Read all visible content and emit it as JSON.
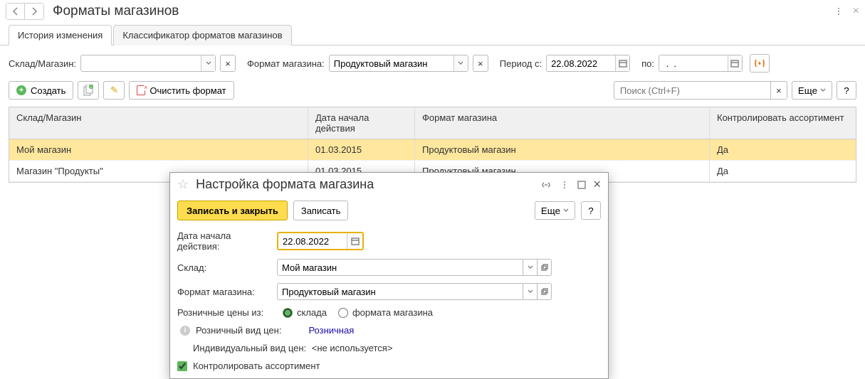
{
  "header": {
    "title": "Форматы магазинов"
  },
  "tabs": {
    "history": "История изменения",
    "classifier": "Классификатор форматов магазинов"
  },
  "filters": {
    "store_label": "Склад/Магазин:",
    "format_label": "Формат магазина:",
    "format_value": "Продуктовый магазин",
    "period_from_label": "Период с:",
    "period_from_value": "22.08.2022",
    "period_to_label": "по:",
    "period_to_value": " .  .    "
  },
  "toolbar": {
    "create": "Создать",
    "clear_format": "Очистить формат",
    "search_placeholder": "Поиск (Ctrl+F)",
    "more": "Еще",
    "help": "?"
  },
  "table": {
    "headers": {
      "store": "Склад/Магазин",
      "date": "Дата начала действия",
      "format": "Формат магазина",
      "control": "Контролировать ассортимент"
    },
    "rows": [
      {
        "store": "Мой магазин",
        "date": "01.03.2015",
        "format": "Продуктовый магазин",
        "control": "Да"
      },
      {
        "store": "Магазин \"Продукты\"",
        "date": "01.03.2015",
        "format": "Продуктовый магазин",
        "control": "Да"
      }
    ]
  },
  "dialog": {
    "title": "Настройка формата магазина",
    "save_close": "Записать и закрыть",
    "save": "Записать",
    "more": "Еще",
    "help": "?",
    "date_label": "Дата начала действия:",
    "date_value": "22.08.2022",
    "store_label": "Склад:",
    "store_value": "Мой магазин",
    "format_label": "Формат магазина:",
    "format_value": "Продуктовый магазин",
    "prices_from_label": "Розничные цены из:",
    "radio_store": "склада",
    "radio_format": "формата магазина",
    "retail_price_type_label": "Розничный вид цен:",
    "retail_price_type_value": "Розничная",
    "individual_price_type_label": "Индивидуальный вид цен:",
    "individual_price_type_value": "<не используется>",
    "control_assortment": "Контролировать ассортимент"
  }
}
